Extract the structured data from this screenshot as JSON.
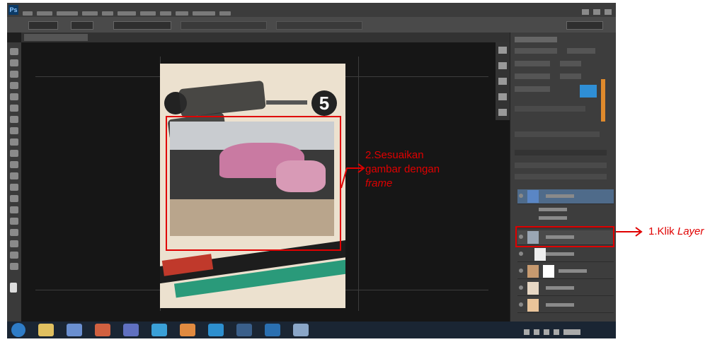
{
  "poster": {
    "number": "5"
  },
  "annotations": {
    "step1": {
      "text": "1.Klik ",
      "emph": "Layer"
    },
    "step2": {
      "line1": "2.Sesuaikan",
      "line2": "gambar dengan",
      "line3": "frame"
    }
  },
  "colors": {
    "annotation": "#e00000",
    "selected_layer": "#4f6b8a",
    "accent_blue": "#2f8fd6"
  },
  "icons": [
    "photoshop-logo",
    "eye-icon",
    "windows-start-icon",
    "arrow-right-icon"
  ]
}
